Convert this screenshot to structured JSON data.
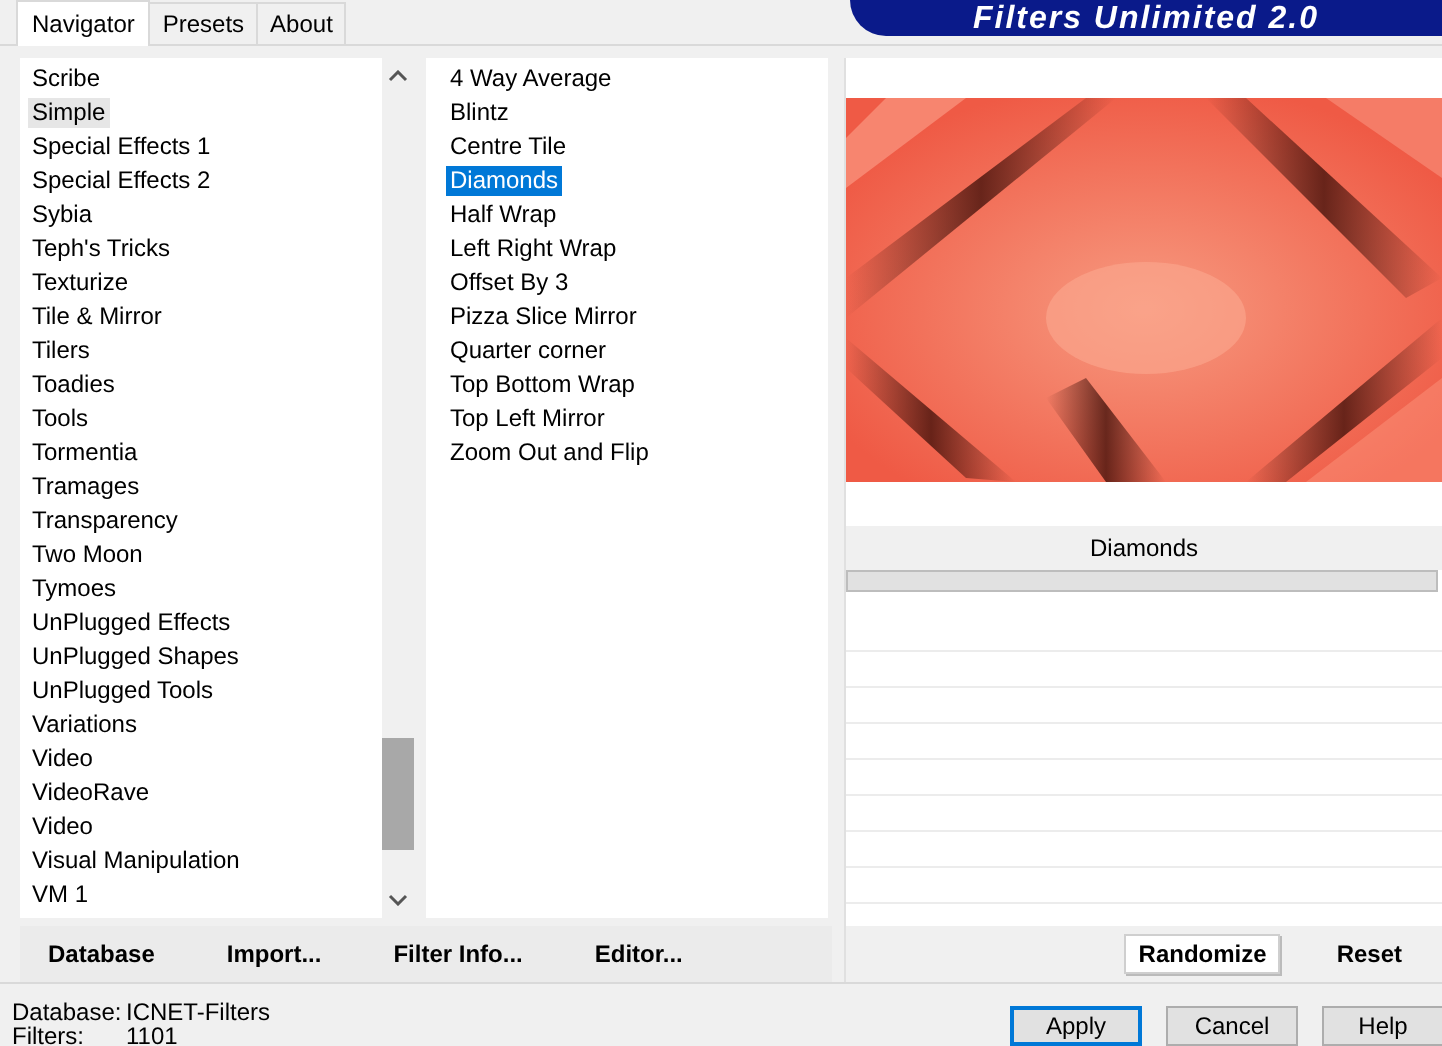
{
  "tabs": [
    {
      "label": "Navigator",
      "selected": true
    },
    {
      "label": "Presets",
      "selected": false
    },
    {
      "label": "About",
      "selected": false
    }
  ],
  "logo": {
    "text": "Filters Unlimited 2.0"
  },
  "categories": [
    {
      "label": "Scribe",
      "selected": false
    },
    {
      "label": "Simple",
      "selected": true
    },
    {
      "label": "Special Effects 1",
      "selected": false
    },
    {
      "label": "Special Effects 2",
      "selected": false
    },
    {
      "label": "Sybia",
      "selected": false
    },
    {
      "label": "Teph's Tricks",
      "selected": false
    },
    {
      "label": "Texturize",
      "selected": false
    },
    {
      "label": "Tile & Mirror",
      "selected": false
    },
    {
      "label": "Tilers",
      "selected": false
    },
    {
      "label": "Toadies",
      "selected": false
    },
    {
      "label": "Tools",
      "selected": false
    },
    {
      "label": "Tormentia",
      "selected": false
    },
    {
      "label": "Tramages",
      "selected": false
    },
    {
      "label": "Transparency",
      "selected": false
    },
    {
      "label": "Two Moon",
      "selected": false
    },
    {
      "label": "Tymoes",
      "selected": false
    },
    {
      "label": "UnPlugged Effects",
      "selected": false
    },
    {
      "label": "UnPlugged Shapes",
      "selected": false
    },
    {
      "label": "UnPlugged Tools",
      "selected": false
    },
    {
      "label": "Variations",
      "selected": false
    },
    {
      "label": "Video",
      "selected": false
    },
    {
      "label": "VideoRave",
      "selected": false
    },
    {
      "label": "Video",
      "selected": false
    },
    {
      "label": "Visual Manipulation",
      "selected": false
    },
    {
      "label": "VM 1",
      "selected": false
    }
  ],
  "filters": [
    {
      "label": "4 Way Average",
      "selected": false
    },
    {
      "label": "Blintz",
      "selected": false
    },
    {
      "label": "Centre Tile",
      "selected": false
    },
    {
      "label": "Diamonds",
      "selected": true
    },
    {
      "label": "Half Wrap",
      "selected": false
    },
    {
      "label": "Left Right Wrap",
      "selected": false
    },
    {
      "label": "Offset By 3",
      "selected": false
    },
    {
      "label": "Pizza Slice Mirror",
      "selected": false
    },
    {
      "label": "Quarter corner",
      "selected": false
    },
    {
      "label": "Top Bottom Wrap",
      "selected": false
    },
    {
      "label": "Top Left Mirror",
      "selected": false
    },
    {
      "label": "Zoom Out and Flip",
      "selected": false
    }
  ],
  "preview": {
    "kind": "picture",
    "filter_name": "Diamonds",
    "progress": {
      "level": 0
    }
  },
  "nav_buttons": [
    "Database",
    "Import...",
    "Filter Info...",
    "Editor..."
  ],
  "preview_buttons": [
    "Randomize",
    "Reset"
  ],
  "status": [
    {
      "label": "Database:",
      "value": "ICNET-Filters"
    },
    {
      "label": "Filters:",
      "value": "1101"
    }
  ],
  "dialog_buttons": [
    {
      "label": "Apply",
      "default": true
    },
    {
      "label": "Cancel",
      "default": false
    },
    {
      "label": "Help",
      "default": false
    }
  ]
}
